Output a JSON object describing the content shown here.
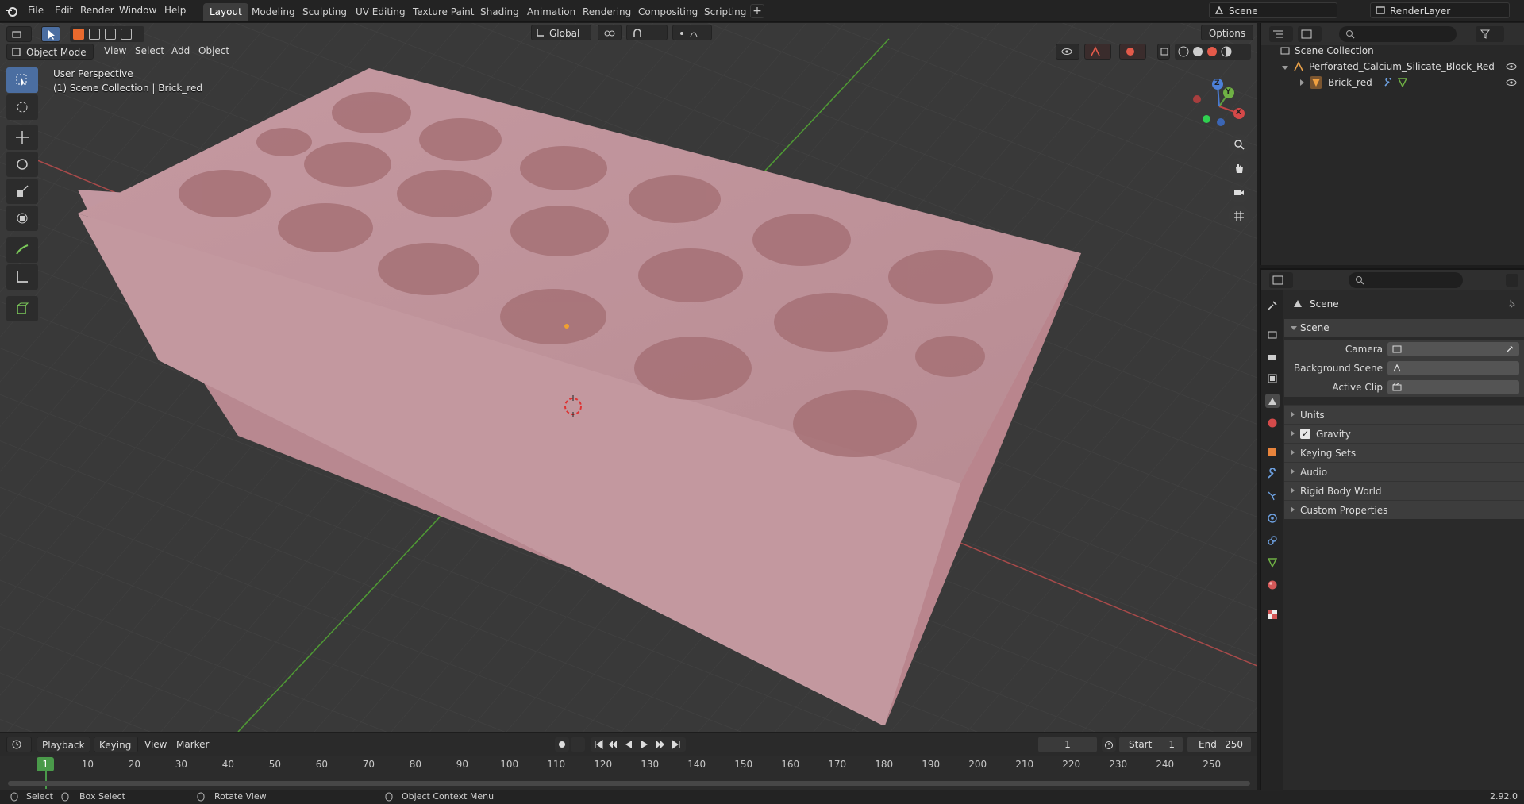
{
  "app": {
    "menus": [
      "File",
      "Edit",
      "Render",
      "Window",
      "Help"
    ],
    "workspaces": [
      "Layout",
      "Modeling",
      "Sculpting",
      "UV Editing",
      "Texture Paint",
      "Shading",
      "Animation",
      "Rendering",
      "Compositing",
      "Scripting"
    ],
    "active_workspace": "Layout",
    "scene_name": "Scene",
    "view_layer": "RenderLayer"
  },
  "viewport": {
    "mode": "Object Mode",
    "menus": [
      "View",
      "Select",
      "Add",
      "Object"
    ],
    "transform_orientation": "Global",
    "options_label": "Options",
    "perspective_label": "User Perspective",
    "collection_label": "(1) Scene Collection | Brick_red",
    "axes": {
      "x": "X",
      "y": "Y",
      "z": "Z"
    },
    "colors": {
      "background": "#393939",
      "grid": "#424242",
      "x_axis": "#b34b4b",
      "y_axis": "#5a9e3a",
      "brick": "#c99aa0"
    }
  },
  "outliner": {
    "root": "Scene Collection",
    "items": [
      {
        "name": "Perforated_Calcium_Silicate_Block_Red",
        "type": "collection"
      },
      {
        "name": "Brick_red",
        "type": "mesh"
      }
    ]
  },
  "properties": {
    "context_title": "Scene",
    "section_title": "Scene",
    "fields": [
      {
        "label": "Camera"
      },
      {
        "label": "Background Scene"
      },
      {
        "label": "Active Clip"
      }
    ],
    "subpanels": [
      "Units",
      "Gravity",
      "Keying Sets",
      "Audio",
      "Rigid Body World",
      "Custom Properties"
    ],
    "gravity_checked": true
  },
  "timeline": {
    "menus": [
      "Playback",
      "Keying",
      "View",
      "Marker"
    ],
    "current_frame": "1",
    "start_label": "Start",
    "start": "1",
    "end_label": "End",
    "end": "250",
    "ticks": [
      "1",
      "10",
      "20",
      "30",
      "40",
      "50",
      "60",
      "70",
      "80",
      "90",
      "100",
      "110",
      "120",
      "130",
      "140",
      "150",
      "160",
      "170",
      "180",
      "190",
      "200",
      "210",
      "220",
      "230",
      "240",
      "250"
    ]
  },
  "statusbar": {
    "select": "Select",
    "box_select": "Box Select",
    "rotate_view": "Rotate View",
    "context_menu": "Object Context Menu",
    "version": "2.92.0"
  }
}
